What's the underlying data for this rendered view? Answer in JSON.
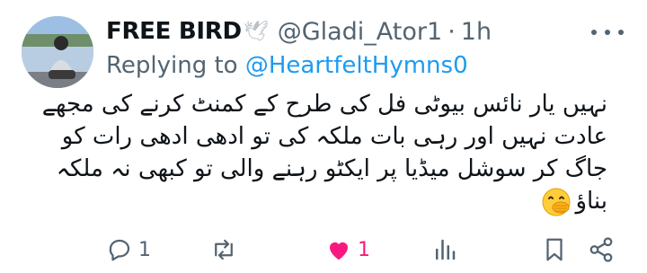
{
  "tweet": {
    "display_name": "FREE BIRD",
    "handle": "@Gladi_Ator1",
    "separator": "·",
    "time": "1h",
    "replying_prefix": "Replying to",
    "replying_to": "@HeartfeltHymns0",
    "text_lines": [
      "نہیں یار نائس بیوٹی فل کی طرح کے کمنٹ کرنے کی مجھے",
      "عادت نہیں اور رہی بات ملکہ کی تو ادھی ادھی رات کو",
      "جاگ کر سوشل میڈیا پر ایکٹو رہنے والی تو کبھی نہ ملکہ",
      "بناؤ"
    ],
    "emoji": "face-with-hand-over-mouth-emoji"
  },
  "actions": {
    "reply_count": "1",
    "retweet_count": "",
    "like_count": "1",
    "views_count": ""
  },
  "colors": {
    "text": "#0f1419",
    "muted": "#536471",
    "link": "#1d9bf0",
    "like": "#f91880"
  }
}
